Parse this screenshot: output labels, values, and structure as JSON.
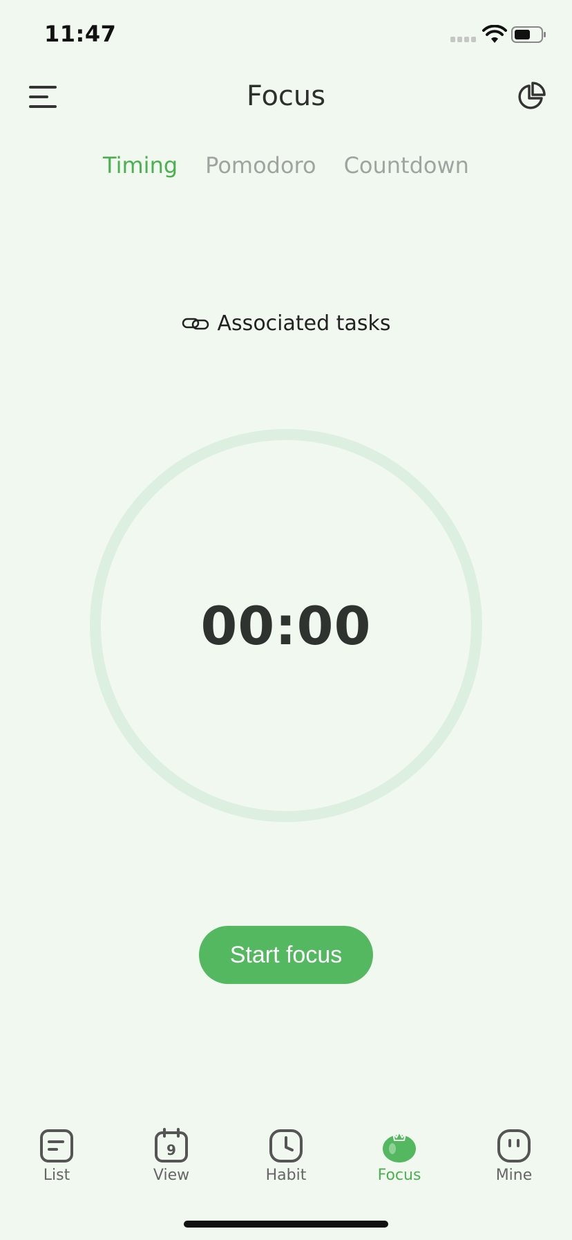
{
  "status": {
    "time": "11:47"
  },
  "header": {
    "title": "Focus"
  },
  "tabs": [
    {
      "label": "Timing",
      "active": true
    },
    {
      "label": "Pomodoro",
      "active": false
    },
    {
      "label": "Countdown",
      "active": false
    }
  ],
  "associated": {
    "label": "Associated tasks"
  },
  "timer": {
    "value": "00:00"
  },
  "start_button": {
    "label": "Start focus"
  },
  "nav": [
    {
      "label": "List",
      "icon": "list-icon"
    },
    {
      "label": "View",
      "icon": "calendar-icon",
      "badge": "9"
    },
    {
      "label": "Habit",
      "icon": "clock-icon"
    },
    {
      "label": "Focus",
      "icon": "tomato-icon",
      "active": true
    },
    {
      "label": "Mine",
      "icon": "face-icon"
    }
  ],
  "colors": {
    "accent": "#53b85f",
    "background": "#f1f8ef",
    "ring": "#dcefe1"
  }
}
